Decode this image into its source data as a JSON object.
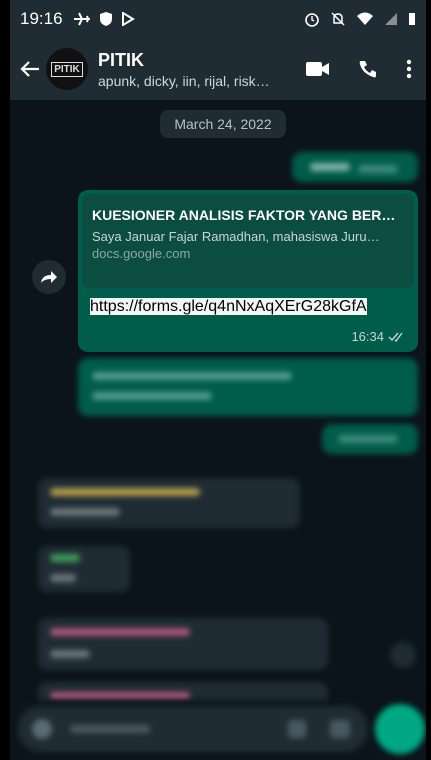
{
  "status_bar": {
    "time": "19:16"
  },
  "header": {
    "group_name": "PITIK",
    "members": "apunk, dicky, iin, rijal, risk…",
    "avatar_text": "PITIK"
  },
  "chat": {
    "date": "March 24, 2022",
    "message": {
      "preview_title": "KUESIONER ANALISIS FAKTOR YANG BERHUBUNGAN DENGAN PERILAKU CU…",
      "preview_description": "Saya Januar Fajar Ramadhan, mahasiswa Juru…",
      "preview_domain": "docs.google.com",
      "link_text": "https://forms.gle/q4nNxAqXErG28kGfA",
      "time": "16:34"
    }
  },
  "colors": {
    "outgoing_bubble": "#005c4b",
    "incoming_bubble": "#1f2c34",
    "background": "#0b141a",
    "accent": "#00a884"
  }
}
